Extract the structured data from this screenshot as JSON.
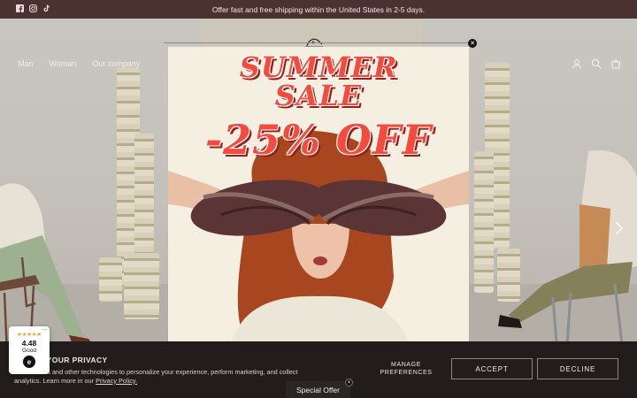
{
  "announcement": {
    "text": "Offer fast and free shipping within the United States in 2-5 days.",
    "social_icons": [
      "facebook-icon",
      "instagram-icon",
      "tiktok-icon"
    ]
  },
  "nav": {
    "items": [
      {
        "label": "Man"
      },
      {
        "label": "Woman"
      },
      {
        "label": "Our company"
      }
    ],
    "icons": [
      "account-icon",
      "search-icon",
      "cart-icon"
    ]
  },
  "popup": {
    "line1": "SUMMER",
    "line2": "SALE",
    "line3": "-25% OFF",
    "close_icon": "close-icon",
    "accent_color": "#f44b3d"
  },
  "cookie": {
    "title": "E YOUR PRIVACY",
    "text_line1": "kies and other technologies to personalize your experience, perform marketing, and collect",
    "text_line2": "analytics. Learn more in our ",
    "policy_link": "Privacy Policy.",
    "manage": "MANAGE PREFERENCES",
    "accept": "ACCEPT",
    "decline": "DECLINE"
  },
  "review_widget": {
    "stars": "★★★★★",
    "score": "4.48",
    "label": "Good",
    "badge": "e",
    "more": "..."
  },
  "special_offer": {
    "label": "Special Offer",
    "close": "×"
  },
  "colors": {
    "announcement_bg": "#4a3230",
    "cookie_bg": "#221d1c",
    "star": "#e9a23b"
  }
}
